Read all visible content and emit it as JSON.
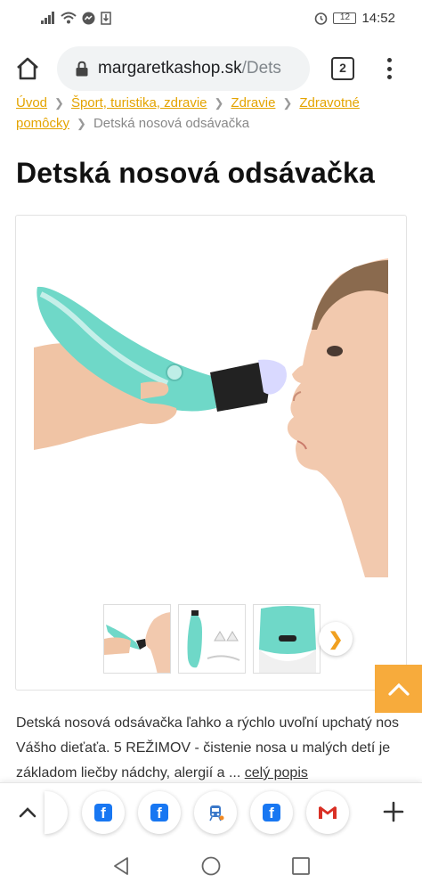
{
  "status_bar": {
    "battery": "12",
    "time": "14:52"
  },
  "browser": {
    "url_domain": "margaretkashop.sk",
    "url_path": "/Dets",
    "tab_count": "2"
  },
  "breadcrumb": {
    "items": [
      "Úvod",
      "Šport, turistika, zdravie",
      "Zdravie",
      "Zdravotné pomôcky"
    ],
    "current": "Detská nosová odsávačka"
  },
  "product": {
    "title": "Detská nosová odsávačka",
    "description": "Detská nosová odsávačka ľahko a rýchlo uvoľní upchatý nos Vášho dieťaťa. 5 REŽIMOV - čistenie nosa u malých detí je základom liečby nádchy, alergií a ...",
    "more_link": "celý popis",
    "accent_color": "#6fd8c8"
  },
  "toolbar": {
    "icons": [
      "chevron-up-icon",
      "facebook-icon",
      "facebook-icon",
      "facebook-icon",
      "train-icon",
      "facebook-icon",
      "gmail-icon",
      "plus-icon"
    ]
  },
  "colors": {
    "link": "#e4a400",
    "scroll_top_bg": "#f7ab3c",
    "facebook": "#1877f2",
    "gmail_red": "#d93025"
  }
}
